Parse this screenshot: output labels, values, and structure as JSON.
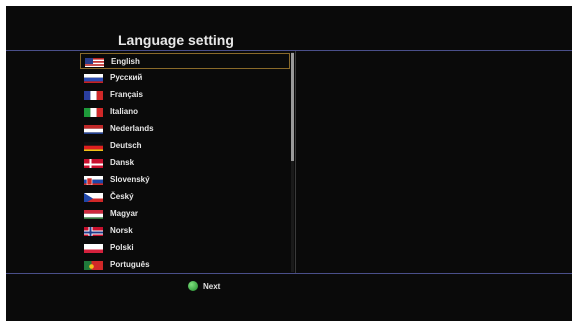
{
  "header": {
    "title": "Language setting"
  },
  "languages": [
    {
      "label": "English",
      "flag": "flag-us-icon"
    },
    {
      "label": "Русский",
      "flag": "flag-ru-icon"
    },
    {
      "label": "Français",
      "flag": "flag-fr-icon"
    },
    {
      "label": "Italiano",
      "flag": "flag-it-icon"
    },
    {
      "label": "Nederlands",
      "flag": "flag-nl-icon"
    },
    {
      "label": "Deutsch",
      "flag": "flag-de-icon"
    },
    {
      "label": "Dansk",
      "flag": "flag-dk-icon"
    },
    {
      "label": "Slovenský",
      "flag": "flag-sk-icon"
    },
    {
      "label": "Český",
      "flag": "flag-cz-icon"
    },
    {
      "label": "Magyar",
      "flag": "flag-hu-icon"
    },
    {
      "label": "Norsk",
      "flag": "flag-no-icon"
    },
    {
      "label": "Polski",
      "flag": "flag-pl-icon"
    },
    {
      "label": "Português",
      "flag": "flag-pt-icon"
    }
  ],
  "selected_language": "English",
  "footer": {
    "next_label": "Next",
    "next_button_color": "#2aa23a"
  },
  "colors": {
    "background": "#0a0a0a",
    "divider": "#4a4f8a",
    "selection_border": "#8a6a2a"
  }
}
